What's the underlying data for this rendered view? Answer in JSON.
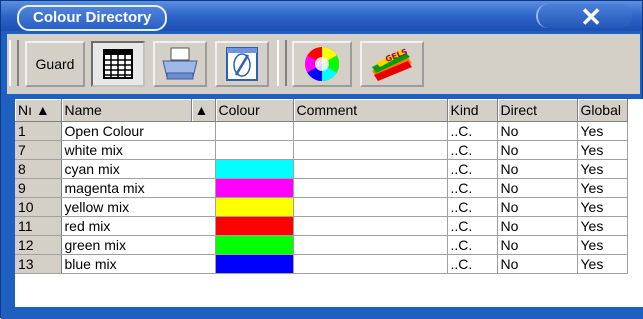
{
  "window": {
    "title": "Colour Directory",
    "close_glyph": "✕"
  },
  "toolbar": {
    "guard_label": "Guard",
    "icons": [
      "sheet-view-icon",
      "printer-icon",
      "edit-doc-icon",
      "colour-wheel-icon",
      "gels-icon"
    ],
    "gels_text": "GELS"
  },
  "grid": {
    "columns": [
      "Nı ▲",
      "Name",
      "▲",
      "Colour",
      "Comment",
      "Kind",
      "Direct",
      "Global"
    ],
    "rows": [
      {
        "num": "1",
        "name": "Open Colour",
        "colour": "",
        "kind": "..C.",
        "direct": "No",
        "global": "Yes"
      },
      {
        "num": "7",
        "name": "white mix",
        "colour": "",
        "kind": "..C.",
        "direct": "No",
        "global": "Yes"
      },
      {
        "num": "8",
        "name": "cyan mix",
        "colour": "#00ffff",
        "kind": "..C.",
        "direct": "No",
        "global": "Yes"
      },
      {
        "num": "9",
        "name": "magenta mix",
        "colour": "#ff00ff",
        "kind": "..C.",
        "direct": "No",
        "global": "Yes"
      },
      {
        "num": "10",
        "name": "yellow mix",
        "colour": "#ffff00",
        "kind": "..C.",
        "direct": "No",
        "global": "Yes"
      },
      {
        "num": "11",
        "name": "red mix",
        "colour": "#ff0000",
        "kind": "..C.",
        "direct": "No",
        "global": "Yes"
      },
      {
        "num": "12",
        "name": "green mix",
        "colour": "#00ff00",
        "kind": "..C.",
        "direct": "No",
        "global": "Yes"
      },
      {
        "num": "13",
        "name": "blue mix",
        "colour": "#0000ff",
        "kind": "..C.",
        "direct": "No",
        "global": "Yes"
      }
    ]
  }
}
